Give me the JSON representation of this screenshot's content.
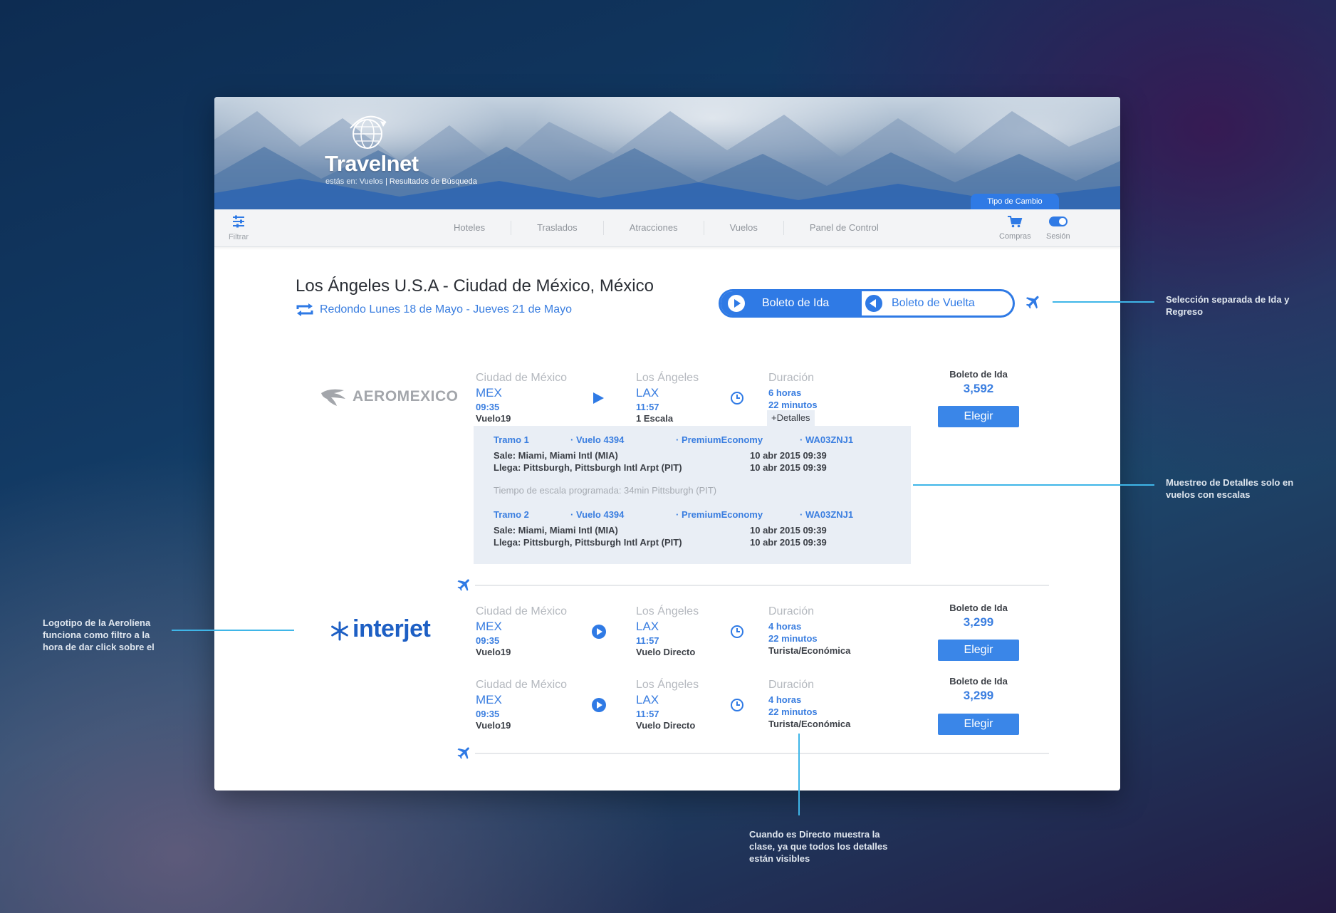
{
  "header": {
    "logo": "Travelnet",
    "crumb_prefix": "estás en: Vuelos",
    "crumb_sep": "|",
    "crumb_current": "Resultados de Búsqueda",
    "exchange": "Tipo de Cambio"
  },
  "nav": {
    "filter": "Filtrar",
    "items": [
      "Hoteles",
      "Traslados",
      "Atracciones",
      "Vuelos",
      "Panel de Control"
    ],
    "cart": "Compras",
    "session": "Sesión"
  },
  "search": {
    "title": "Los Ángeles U.S.A - Ciudad de México, México",
    "subtitle": "Redondo Lunes 18 de Mayo - Jueves 21 de Mayo",
    "tab_outbound": "Boleto de Ida",
    "tab_return": "Boleto de Vuelta"
  },
  "airlines": {
    "aeromexico": "AeroMexico",
    "interjet": "interjet"
  },
  "flights": [
    {
      "from_city": "Ciudad de México",
      "from_code": "MEX",
      "dep_time": "09:35",
      "flight": "Vuelo19",
      "to_city": "Los Ángeles",
      "to_code": "LAX",
      "arr_time": "11:57",
      "stops": "1 Escala",
      "dur_label": "Duración",
      "dur_h": "6 horas",
      "dur_m": "22 minutos",
      "price_label": "Boleto de Ida",
      "price": "3,592",
      "choose": "Elegir"
    },
    {
      "from_city": "Ciudad de México",
      "from_code": "MEX",
      "dep_time": "09:35",
      "flight": "Vuelo19",
      "to_city": "Los Ángeles",
      "to_code": "LAX",
      "arr_time": "11:57",
      "stops": "Vuelo Directo",
      "dur_label": "Duración",
      "dur_h": "4 horas",
      "dur_m": "22 minutos",
      "class": "Turista/Económica",
      "price_label": "Boleto de Ida",
      "price": "3,299",
      "choose": "Elegir"
    },
    {
      "from_city": "Ciudad de México",
      "from_code": "MEX",
      "dep_time": "09:35",
      "flight": "Vuelo19",
      "to_city": "Los Ángeles",
      "to_code": "LAX",
      "arr_time": "11:57",
      "stops": "Vuelo Directo",
      "dur_label": "Duración",
      "dur_h": "4 horas",
      "dur_m": "22 minutos",
      "class": "Turista/Económica",
      "price_label": "Boleto de Ida",
      "price": "3,299",
      "choose": "Elegir"
    }
  ],
  "details": {
    "more": "+Detalles",
    "legs": [
      {
        "tramo": "Tramo 1",
        "vuelo": "· Vuelo 4394",
        "cabin": "· PremiumEconomy",
        "code": "· WA03ZNJ1",
        "sale": "Sale: Miami, Miami Intl (MIA)",
        "sale_date": "10 abr 2015 09:39",
        "llega": "Llega: Pittsburgh, Pittsburgh Intl Arpt (PIT)",
        "llega_date": "10 abr 2015 09:39"
      },
      {
        "tramo": "Tramo 2",
        "vuelo": "· Vuelo 4394",
        "cabin": "· PremiumEconomy",
        "code": "· WA03ZNJ1",
        "sale": "Sale: Miami, Miami Intl (MIA)",
        "sale_date": "10 abr 2015 09:39",
        "llega": "Llega: Pittsburgh, Pittsburgh Intl Arpt (PIT)",
        "llega_date": "10 abr 2015 09:39"
      }
    ],
    "layover": "Tiempo de escala programada: 34min  Pittsburgh (PIT)"
  },
  "annotations": {
    "a1": [
      "Selección separada de Ida y",
      "Regreso"
    ],
    "a2": [
      "Muestreo de Detalles solo en",
      "vuelos con escalas"
    ],
    "a3": [
      "Logotipo de la Aerolíena",
      "funciona como filtro a la",
      "hora de dar click sobre el"
    ],
    "a4": [
      "Cuando es Directo muestra la",
      "clase, ya que todos los detalles",
      "están visibles"
    ]
  },
  "colors": {
    "accent": "#3a86e8",
    "annotation_line": "#3fb6e8"
  }
}
